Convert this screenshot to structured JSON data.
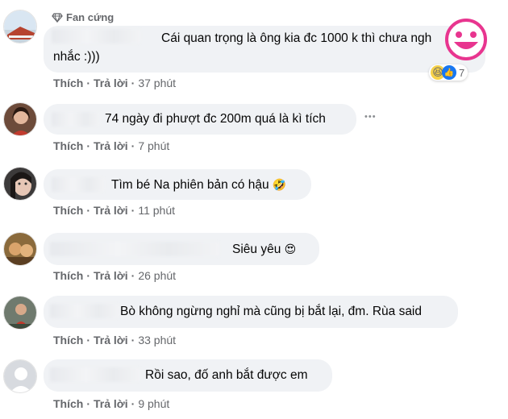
{
  "badge": {
    "label": "Fan cứng",
    "icon": "diamond-icon"
  },
  "actions": {
    "like": "Thích",
    "reply": "Trả lời"
  },
  "comments": [
    {
      "text_line1": "Cái quan trọng là ông kia đc 1000 k thì chưa ngh",
      "text_line2": "nhắc :)))",
      "time": "37 phút",
      "reaction_count": "7"
    },
    {
      "text": "74 ngày đi phượt đc 200m quá là kì tích",
      "time": "7 phút"
    },
    {
      "text": "Tìm bé Na phiên bản có hậu",
      "emoji": "🤣",
      "time": "11 phút"
    },
    {
      "text": "Siêu yêu",
      "emoji": "😍",
      "time": "26 phút"
    },
    {
      "text": "Bò không ngừng nghỉ mà cũng bị bắt lại, đm. Rùa said",
      "time": "33 phút"
    },
    {
      "text": "Rồi sao, đố anh bắt được em",
      "time": "9 phút"
    }
  ],
  "reaction_emojis": [
    "😆",
    "👍"
  ],
  "more_label": "•••",
  "colors": {
    "bubble": "#f0f2f5",
    "action_gray": "#65676b",
    "smiley_pink": "#e8358f"
  }
}
